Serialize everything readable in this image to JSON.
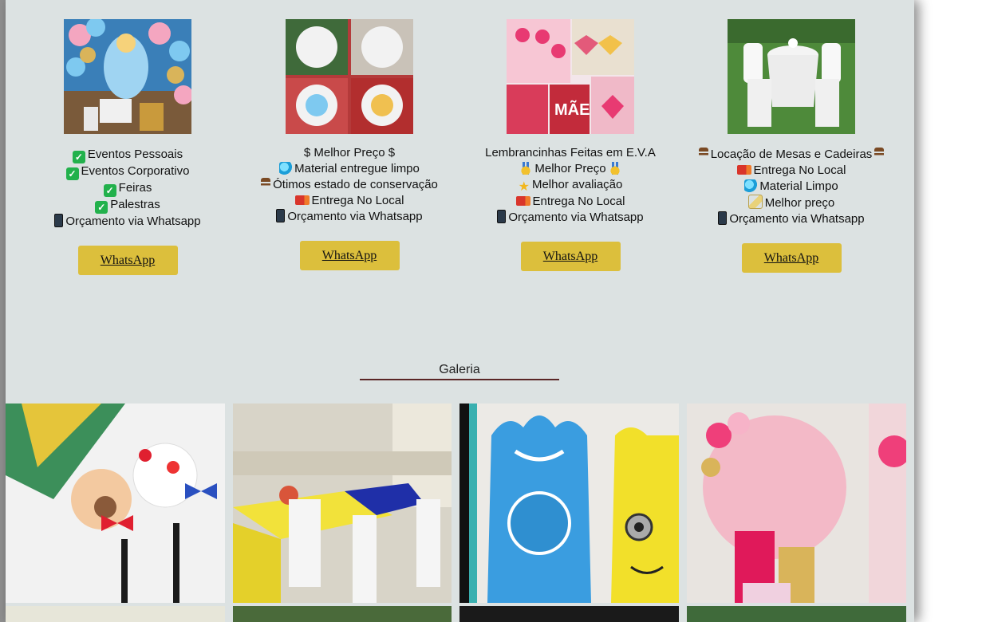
{
  "services": [
    {
      "image_alt": "Decoração infantil Cinderela com balões",
      "lines": [
        {
          "icon": "check-icon",
          "text": "Eventos Pessoais"
        },
        {
          "icon": "check-icon",
          "text": "Eventos Corporativo"
        },
        {
          "icon": "check-icon",
          "text": "Feiras"
        },
        {
          "icon": "check-icon",
          "text": "Palestras"
        },
        {
          "icon": "phone-icon",
          "text": "Orçamento via Whatsapp"
        }
      ],
      "button": "WhatsApp"
    },
    {
      "image_alt": "Painéis redondos de decoração",
      "lines": [
        {
          "icon": "",
          "text": "$ Melhor Preço $"
        },
        {
          "icon": "droplets-icon",
          "text": "Material entregue limpo"
        },
        {
          "icon": "chair-icon",
          "text": "Ótimos estado de conservação"
        },
        {
          "icon": "truck-icon",
          "text": "Entrega No Local"
        },
        {
          "icon": "phone-icon",
          "text": "Orçamento via Whatsapp"
        }
      ],
      "button": "WhatsApp"
    },
    {
      "image_alt": "Lembrancinhas em E.V.A",
      "lines": [
        {
          "icon": "",
          "text": "Lembrancinhas Feitas em E.V.A"
        },
        {
          "icon": "medal-icon",
          "text": "Melhor Preço",
          "icon_after": "medal-icon"
        },
        {
          "icon": "star-icon",
          "text": "Melhor avaliação"
        },
        {
          "icon": "truck-icon",
          "text": "Entrega No Local"
        },
        {
          "icon": "phone-icon",
          "text": "Orçamento via Whatsapp"
        }
      ],
      "button": "WhatsApp"
    },
    {
      "image_alt": "Mesa e cadeiras brancas",
      "lines": [
        {
          "icon": "chair-icon",
          "text": "Locação de Mesas e Cadeiras",
          "icon_after": "chair-icon"
        },
        {
          "icon": "truck-icon",
          "text": "Entrega No Local"
        },
        {
          "icon": "droplets-icon",
          "text": "Material Limpo"
        },
        {
          "icon": "broom-icon",
          "text": "Melhor preço"
        },
        {
          "icon": "phone-icon",
          "text": "Orçamento via Whatsapp"
        }
      ],
      "button": "WhatsApp"
    }
  ],
  "gallery": {
    "title": "Galeria"
  },
  "colors": {
    "background": "#dce2e2",
    "button": "#dcbf3c",
    "title_underline": "#5a2626"
  }
}
